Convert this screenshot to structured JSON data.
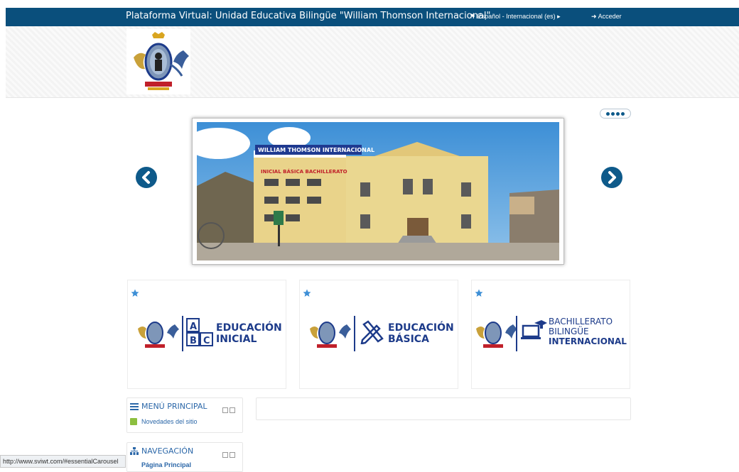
{
  "topbar": {
    "title": "Plataforma Virtual: Unidad Educativa Bilingüe \"William Thomson Internacional\"",
    "language": "Español - Internacional (es)",
    "login": "Acceder",
    "flag_icon": "flag-icon",
    "login_icon": "sign-in-icon",
    "caret_icon": "caret-right-icon",
    "bg_color": "#0a4f7c"
  },
  "carousel": {
    "indicator_count": 4,
    "accent_color": "#0e5a8a",
    "slide": {
      "sign_top": "WILLIAM THOMSON INTERNACIONAL",
      "sign_bottom": "INICIAL BÁSICA BACHILLERATO"
    }
  },
  "cards": [
    {
      "icon": "abc-blocks-icon",
      "line1": "EDUCACIÓN",
      "line2": "INICIAL",
      "star_icon": "star-icon"
    },
    {
      "icon": "pencil-ruler-icon",
      "line1": "EDUCACIÓN",
      "line2": "BÁSICA",
      "star_icon": "star-icon"
    },
    {
      "icon": "graduation-laptop-icon",
      "line1": "BACHILLERATO",
      "line2": "BILINGÜE",
      "line3": "INTERNACIONAL",
      "star_icon": "star-icon"
    }
  ],
  "blocks": {
    "main_menu": {
      "title": "MENÚ PRINCIPAL",
      "items": [
        "Novedades del sitio"
      ],
      "icon": "bars-icon"
    },
    "navigation": {
      "title": "NAVEGACIÓN",
      "items": [
        "Página Principal"
      ],
      "icon": "sitemap-icon"
    }
  },
  "status_url": "http://www.sviwt.com/#essentialCarousel"
}
